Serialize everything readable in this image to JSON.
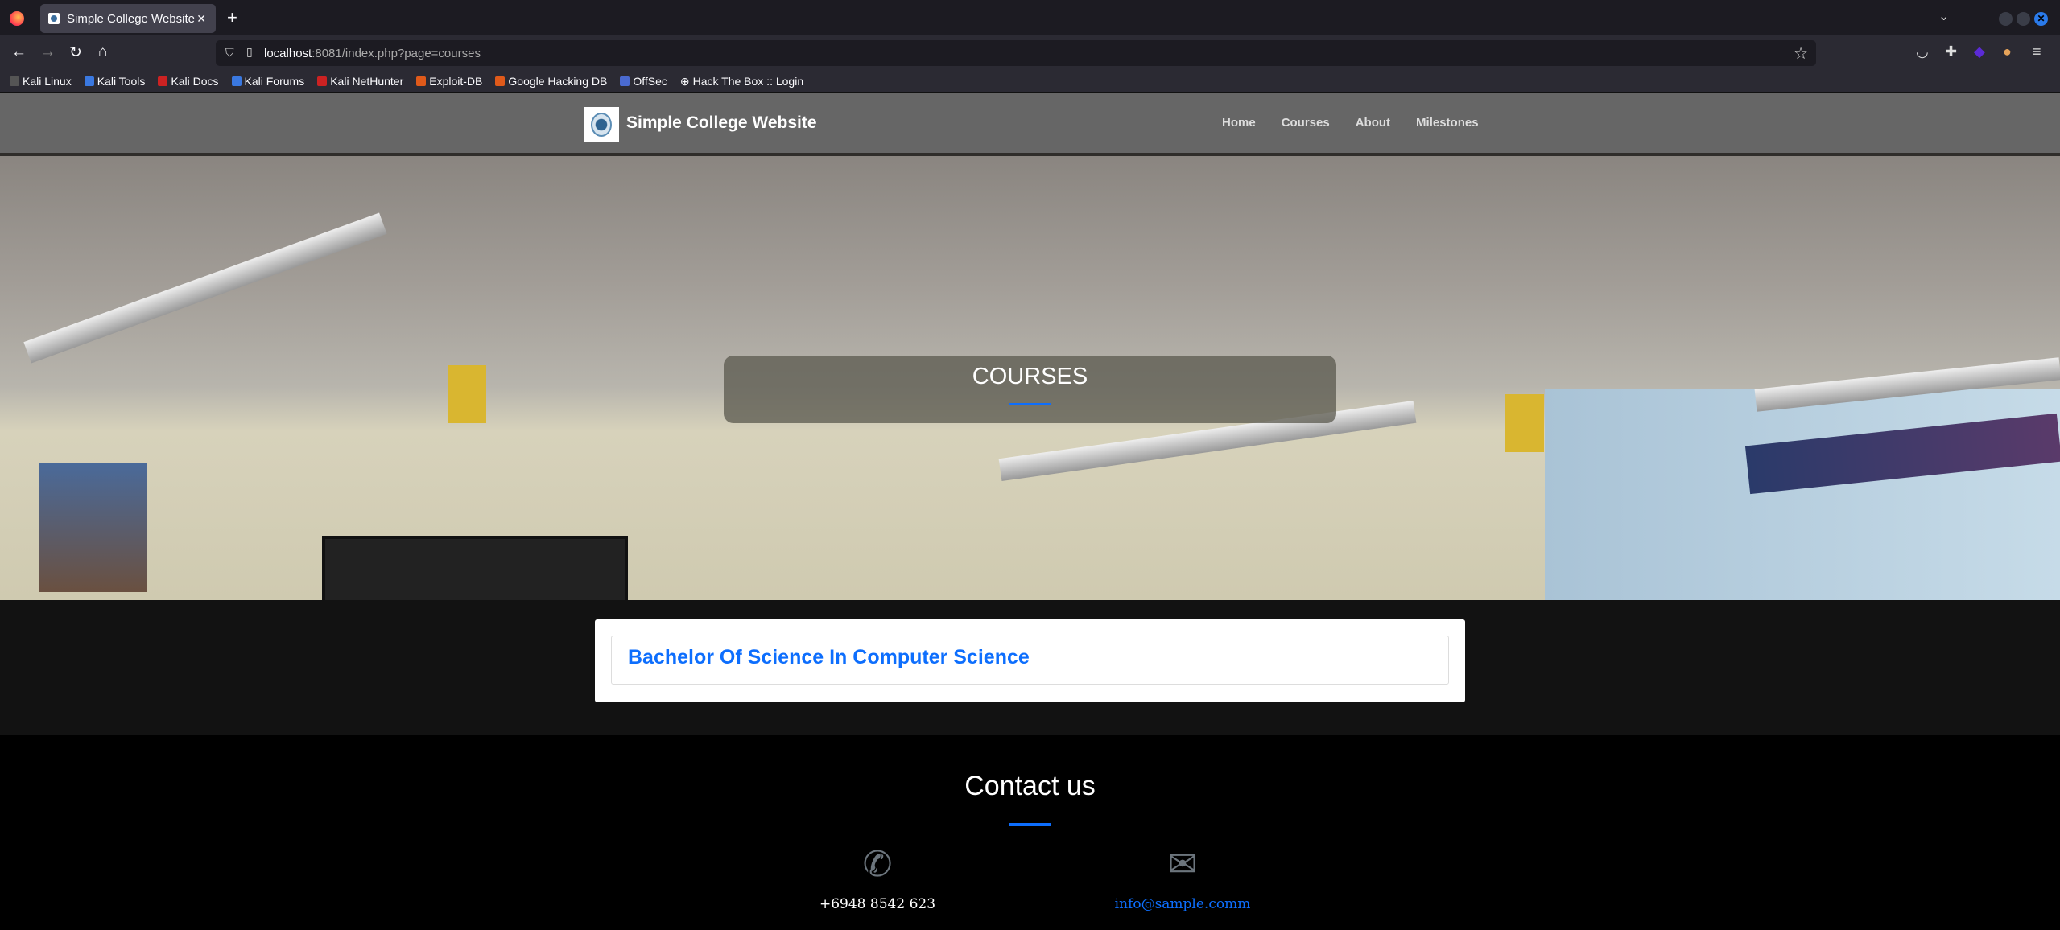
{
  "browser": {
    "tab_title": "Simple College Website",
    "url_host": "localhost",
    "url_rest": ":8081/index.php?page=courses",
    "bookmarks": [
      "Kali Linux",
      "Kali Tools",
      "Kali Docs",
      "Kali Forums",
      "Kali NetHunter",
      "Exploit-DB",
      "Google Hacking DB",
      "OffSec",
      "Hack The Box :: Login"
    ]
  },
  "site": {
    "brand": "Simple College Website",
    "nav": [
      "Home",
      "Courses",
      "About",
      "Milestones"
    ],
    "hero_title": "COURSES",
    "courses": [
      "Bachelor Of Science In Computer Science"
    ],
    "contact": {
      "title": "Contact us",
      "phone": "+6948 8542 623",
      "email": "info@sample.comm"
    }
  }
}
